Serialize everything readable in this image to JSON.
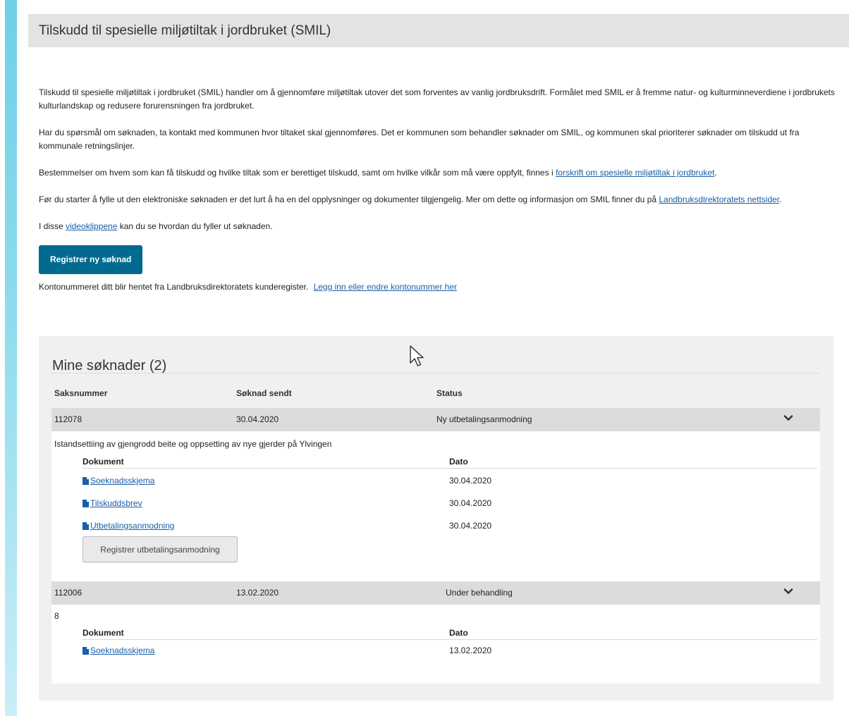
{
  "header": {
    "title": "Tilskudd til spesielle miljøtiltak i jordbruket (SMIL)"
  },
  "intro": {
    "p1": "Tilskudd til spesielle miljøtiltak i jordbruket (SMIL) handler om å gjennomføre miljøtiltak utover det som forventes av vanlig jordbruksdrift. Formålet med SMIL er å fremme natur- og kulturminneverdiene i jordbrukets kulturlandskap og redusere forurensningen fra jordbruket.",
    "p2": "Har du spørsmål om søknaden, ta kontakt med kommunen hvor tiltaket skal gjennomføres. Det er kommunen som behandler søknader om SMIL, og kommunen skal prioriterer søknader om tilskudd ut fra kommunale retningslinjer.",
    "p3_text": "Bestemmelser om hvem som kan få tilskudd og hvilke tiltak som er berettiget tilskudd, samt om hvilke vilkår som må være oppfylt, finnes i ",
    "p3_link": "forskrift om spesielle miljøtiltak i jordbruket",
    "p3_end": ".",
    "p4_text": "Før du starter å fylle ut den elektroniske søknaden er det lurt å ha en del opplysninger og dokumenter tilgjengelig. Mer om dette og informasjon om SMIL finner du på ",
    "p4_link": "Landbruksdirektoratets nettsider",
    "p4_end": ".",
    "p5_text": "I disse ",
    "p5_link": "videoklippene",
    "p5_end": " kan du se hvordan du fyller ut søknaden."
  },
  "register_button": "Registrer ny søknad",
  "account": {
    "text": "Kontonummeret ditt blir hentet fra Landbruksdirektoratets kunderegister.",
    "link": "Legg inn eller endre kontonummer her"
  },
  "applications": {
    "title": "Mine søknader (2)",
    "columns": {
      "case": "Saksnummer",
      "sent": "Søknad sendt",
      "status": "Status"
    },
    "doc_columns": {
      "doc": "Dokument",
      "date": "Dato"
    },
    "items": [
      {
        "case": "112078",
        "sent": "30.04.2020",
        "status": "Ny utbetalingsanmodning",
        "description": "Istandsettiing av gjengrodd beite og oppsetting av nye gjerder på Ylvingen",
        "documents": [
          {
            "name": "Soeknadsskjema",
            "date": "30.04.2020"
          },
          {
            "name": "Tilskuddsbrev",
            "date": "30.04.2020"
          },
          {
            "name": "Utbetalingsanmodning",
            "date": "30.04.2020"
          }
        ],
        "action_button": "Registrer utbetalingsanmodning"
      },
      {
        "case": "112006",
        "sent": "13.02.2020",
        "status": "Under behandling",
        "description": "8",
        "documents": [
          {
            "name": "Soeknadsskjema",
            "date": "13.02.2020"
          }
        ]
      }
    ]
  },
  "icons": {
    "expand": "chevron-down-icon",
    "file": "file-icon",
    "pointer": "mouse-cursor-icon"
  },
  "colors": {
    "accent": "#6fd0e8",
    "primary_button": "#006b8f",
    "link": "#1a5fa6"
  }
}
